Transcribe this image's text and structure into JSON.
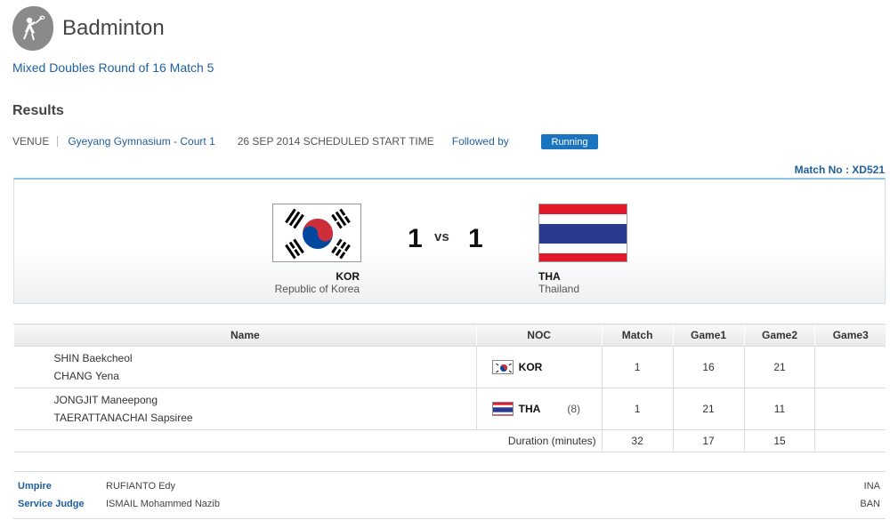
{
  "header": {
    "title": "Badminton",
    "icon": "badminton-icon"
  },
  "subtitle": "Mixed Doubles Round of 16 Match 5",
  "results_title": "Results",
  "meta": {
    "venue_label": "VENUE",
    "venue": "Gyeyang Gymnasium - Court 1",
    "date_time": "26 SEP 2014 SCHEDULED START TIME",
    "followed_by": "Followed by",
    "status": "Running"
  },
  "match_no": "Match No : XD521",
  "score": {
    "left": {
      "code": "KOR",
      "name": "Republic of Korea",
      "score": "1"
    },
    "vs": "vs",
    "right": {
      "code": "THA",
      "name": "Thailand",
      "score": "1"
    }
  },
  "table": {
    "headers": [
      "Name",
      "NOC",
      "Match",
      "Game1",
      "Game2",
      "Game3"
    ],
    "rows": [
      {
        "player1": "SHIN Baekcheol",
        "player2": "CHANG Yena",
        "noc": "KOR",
        "seed": "",
        "match": "1",
        "game1": "16",
        "game2": "21",
        "game3": ""
      },
      {
        "player1": "JONGJIT Maneepong",
        "player2": "TAERATTANACHAI Sapsiree",
        "noc": "THA",
        "seed": "(8)",
        "match": "1",
        "game1": "21",
        "game2": "11",
        "game3": ""
      }
    ],
    "duration": {
      "label": "Duration (minutes)",
      "match": "32",
      "game1": "17",
      "game2": "15",
      "game3": ""
    }
  },
  "officials": [
    {
      "role": "Umpire",
      "name": "RUFIANTO Edy",
      "noc": "INA"
    },
    {
      "role": "Service Judge",
      "name": "ISMAIL Mohammed Nazib",
      "noc": "BAN"
    }
  ],
  "colors": {
    "link": "#1f5f9e",
    "badge": "#1b74bf",
    "tha_red": "#e1192a",
    "tha_blue": "#2a3a8f",
    "kor_red": "#cd2e3a",
    "kor_blue": "#0047a0"
  }
}
